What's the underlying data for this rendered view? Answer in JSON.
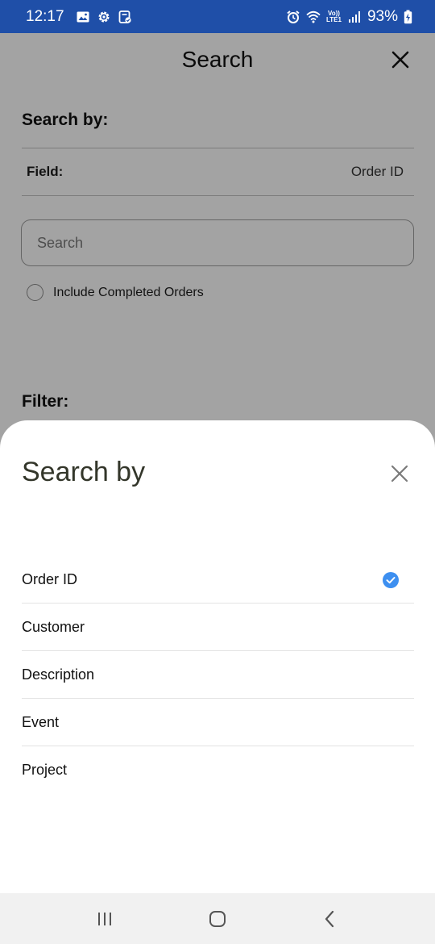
{
  "status_bar": {
    "time": "12:17",
    "battery": "93%",
    "volte_line1": "Vo))",
    "volte_line2": "LTE1",
    "bg_color": "#1f4fa8",
    "left_icons": [
      "image-icon",
      "settings-gear-icon",
      "clipboard-check-icon"
    ],
    "right_icons": [
      "alarm-icon",
      "wifi-icon",
      "volte-lte-icon",
      "signal-icon",
      "battery-charging-icon"
    ]
  },
  "background_page": {
    "title": "Search",
    "search_by_label": "Search by:",
    "field_label": "Field:",
    "field_value": "Order ID",
    "search_placeholder": "Search",
    "include_completed_label": "Include Completed Orders",
    "filter_label": "Filter:"
  },
  "sheet": {
    "title": "Search by",
    "options": [
      {
        "label": "Order ID",
        "selected": true
      },
      {
        "label": "Customer",
        "selected": false
      },
      {
        "label": "Description",
        "selected": false
      },
      {
        "label": "Event",
        "selected": false
      },
      {
        "label": "Project",
        "selected": false
      }
    ],
    "check_color": "#3d8ff0"
  },
  "nav_bar": {
    "buttons": [
      "recents-icon",
      "home-icon",
      "back-icon"
    ]
  }
}
